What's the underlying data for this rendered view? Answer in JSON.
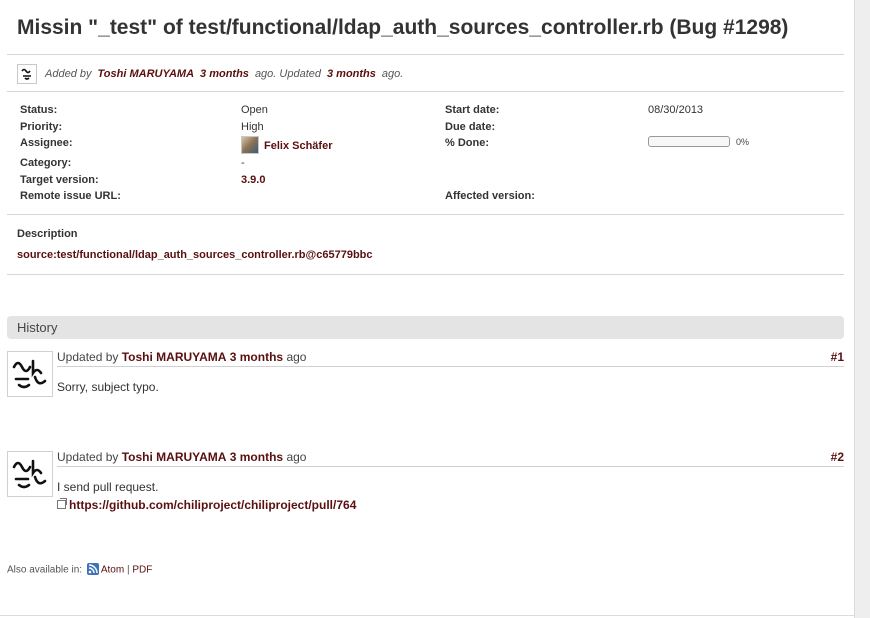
{
  "issue": {
    "title": "Missin \"_test\" of test/functional/ldap_auth_sources_controller.rb (Bug #1298)",
    "added_by_label": "Added by",
    "author": "Toshi MARUYAMA",
    "created_ago": "3 months",
    "ago_updated_label": "ago. Updated",
    "updated_ago": "3 months",
    "ago_end": "ago."
  },
  "attributes": {
    "status_label": "Status:",
    "status": "Open",
    "priority_label": "Priority:",
    "priority": "High",
    "assignee_label": "Assignee:",
    "assignee": "Felix Schäfer",
    "category_label": "Category:",
    "category": "-",
    "target_version_label": "Target version:",
    "target_version": "3.9.0",
    "remote_issue_url_label": "Remote issue URL:",
    "start_date_label": "Start date:",
    "start_date": "08/30/2013",
    "due_date_label": "Due date:",
    "done_label": "% Done:",
    "done_pct_text": "0%",
    "done_fraction": 0,
    "affected_version_label": "Affected version:"
  },
  "description": {
    "title": "Description",
    "link": "source:test/functional/ldap_auth_sources_controller.rb@c65779bbc"
  },
  "history": {
    "title": "History",
    "entries": [
      {
        "updated_by_label": "Updated by",
        "author": "Toshi MARUYAMA",
        "when": "3 months",
        "ago": "ago",
        "number": "#1",
        "text": "Sorry, subject typo."
      },
      {
        "updated_by_label": "Updated by",
        "author": "Toshi MARUYAMA",
        "when": "3 months",
        "ago": "ago",
        "number": "#2",
        "text": "I send pull request.",
        "link": "https://github.com/chiliproject/chiliproject/pull/764"
      }
    ]
  },
  "footer": {
    "label": "Also available in:",
    "atom": "Atom",
    "separator": "|",
    "pdf": "PDF"
  },
  "colors": {
    "link": "#5a0f0f",
    "history_bar": "#e4e4e4",
    "feed_icon": "#3f73b8"
  }
}
